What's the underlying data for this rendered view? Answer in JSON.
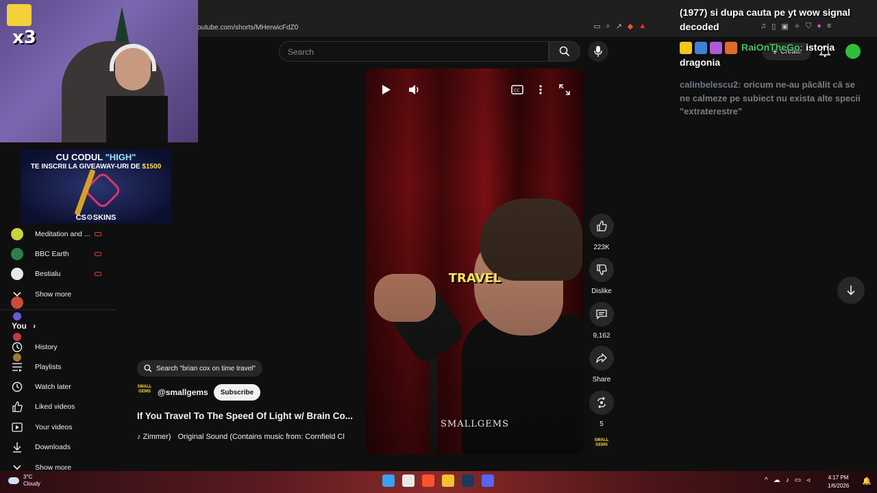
{
  "browser": {
    "url": "outube.com/shorts/MHerwicFdZ0"
  },
  "header": {
    "search_placeholder": "Search",
    "create_label": "Create"
  },
  "ad": {
    "line1_prefix": "CU CODUL ",
    "line1_code": "\"HIGH\"",
    "line2_prefix": "TE INSCRII LA GIVEAWAY-URI DE ",
    "line2_amount": "$1500",
    "brand": "CS⚙SKINS"
  },
  "webcam": {
    "badge": "x3"
  },
  "sidebar": {
    "channels": [
      {
        "label": "Meditation and ...",
        "color": "#c9d33a"
      },
      {
        "label": "BBC Earth",
        "color": "#2e7d4a"
      },
      {
        "label": "Bestialu",
        "color": "#e8e8e8"
      }
    ],
    "show_more_1": "Show more",
    "you_heading": "You",
    "you_items": [
      {
        "label": "History",
        "icon": "history-icon"
      },
      {
        "label": "Playlists",
        "icon": "playlists-icon"
      },
      {
        "label": "Watch later",
        "icon": "clock-icon"
      },
      {
        "label": "Liked videos",
        "icon": "thumb-up-icon"
      },
      {
        "label": "Your videos",
        "icon": "play-square-icon"
      },
      {
        "label": "Downloads",
        "icon": "download-icon"
      }
    ],
    "show_more_2": "Show more"
  },
  "player": {
    "caption": "TRAVEL",
    "watermark": "SMALLGEMS"
  },
  "actions": {
    "likes": "223K",
    "dislike_label": "Dislike",
    "comments": "9,162",
    "share_label": "Share",
    "remix_count": "5"
  },
  "video": {
    "related_search": "Search \"brian cox on time travel\"",
    "channel_handle": "@smallgems",
    "channel_logo_text": "SMALL GEMS",
    "subscribe_label": "Subscribe",
    "title": "If You Travel To The Speed Of Light w/ Brain Co...",
    "sound_artist": "♪ Zimmer)",
    "sound_title": "Original Sound (Contains music from: Cornfield Cl"
  },
  "chat": {
    "msg1": "(1977) si dupa cauta pe yt wow signal decoded",
    "msg2_user": "RaiOnTheGo:",
    "msg2_text": "istoria dragonia",
    "msg3_user": "calinbelescu2:",
    "msg3_text": "oricum ne-au păcălit că se ne calmeze pe subiect nu exista alte specii \"extraterestre\""
  },
  "taskbar": {
    "temp": "3°C",
    "weather": "Cloudy",
    "time": "4:17 PM",
    "date": "1/6/2026"
  },
  "colors": {
    "accent_red": "#e03a3a",
    "chat_user_green": "#46c55f",
    "caption_yellow": "#ffe25a"
  }
}
